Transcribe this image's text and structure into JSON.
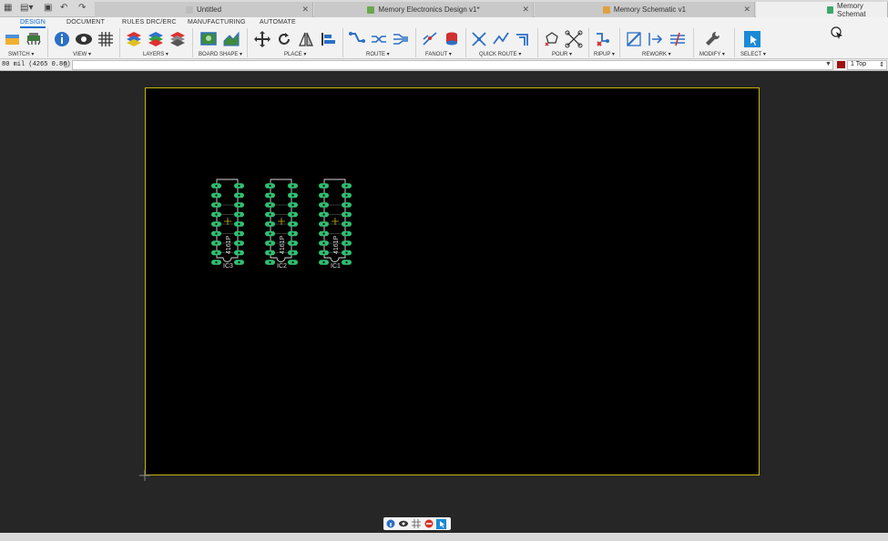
{
  "app": {
    "tabs": [
      {
        "label": "Untitled",
        "active": false
      },
      {
        "label": "Memory Electronics Design v1*",
        "active": false
      },
      {
        "label": "Memory Schematic v1",
        "active": false
      },
      {
        "label": "Memory Schemat",
        "active": true
      }
    ]
  },
  "ribbon": {
    "tabs": [
      "DESIGN",
      "DOCUMENT",
      "RULES DRC/ERC",
      "MANUFACTURING",
      "AUTOMATE"
    ],
    "groups": [
      "SWITCH ▾",
      "VIEW ▾",
      "LAYERS ▾",
      "BOARD SHAPE ▾",
      "PLACE ▾",
      "ROUTE ▾",
      "FANOUT ▾",
      "QUICK ROUTE ▾",
      "POUR ▾",
      "RIPUP ▾",
      "REWORK ▾",
      "MODIFY ▾",
      "SELECT ▾"
    ]
  },
  "commandline": {
    "coords": "80 mil (4265 0.86)",
    "layer": "1 Top",
    "layer_color": "#a01010"
  },
  "board": {
    "parts": [
      {
        "ref": "IC3",
        "value": "4161P"
      },
      {
        "ref": "IC2",
        "value": "4161P"
      },
      {
        "ref": "IC1",
        "value": "4161P"
      }
    ],
    "pad_color": "#2fbf71",
    "outline_color": "#c9b400"
  },
  "navbar": {
    "icons": [
      "info-icon",
      "eye-icon",
      "grid-icon",
      "stop-icon",
      "select-icon"
    ]
  }
}
